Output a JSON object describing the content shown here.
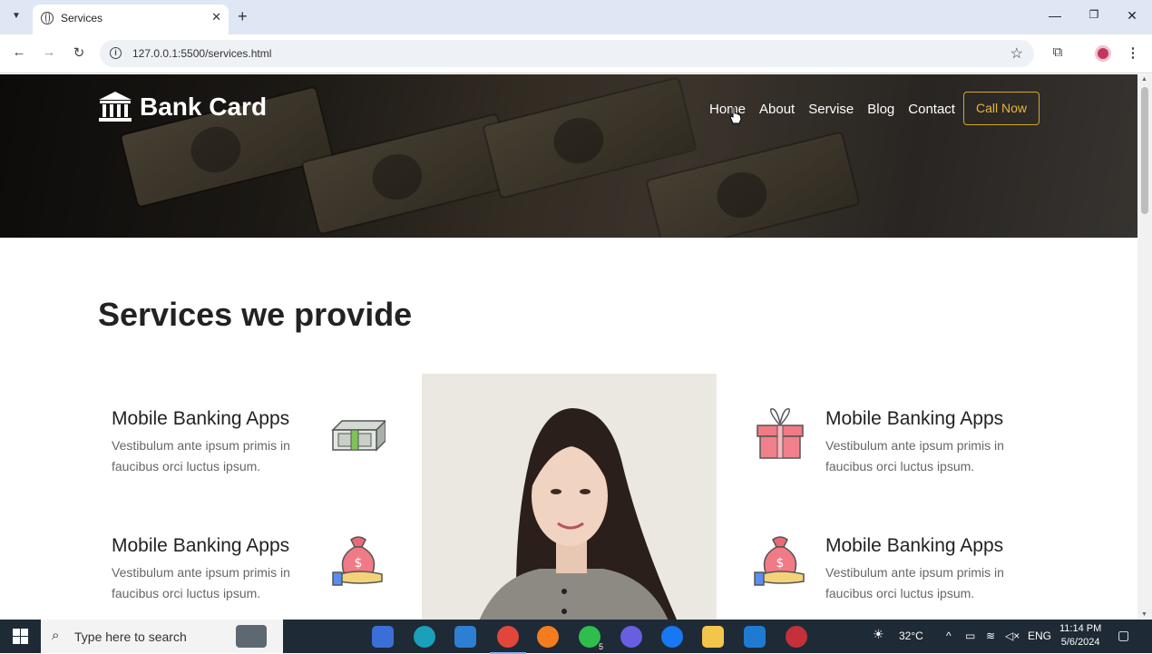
{
  "browser": {
    "tab_title": "Services",
    "url": "127.0.0.1:5500/services.html"
  },
  "site": {
    "brand": "Bank Card",
    "nav": [
      "Home",
      "About",
      "Servise",
      "Blog",
      "Contact"
    ],
    "cta": "Call Now"
  },
  "section": {
    "title_normal": "Services",
    "title_bold": "we provide"
  },
  "services": [
    {
      "title": "Mobile Banking Apps",
      "desc": "Vestibulum ante ipsum primis in faucibus orci luctus ipsum.",
      "icon": "cash-icon"
    },
    {
      "title": "Mobile Banking Apps",
      "desc": "Vestibulum ante ipsum primis in faucibus orci luctus ipsum.",
      "icon": "gift-icon"
    },
    {
      "title": "Mobile Banking Apps",
      "desc": "Vestibulum ante ipsum primis in faucibus orci luctus ipsum.",
      "icon": "money-bag-hand-icon"
    },
    {
      "title": "Mobile Banking Apps",
      "desc": "Vestibulum ante ipsum primis in faucibus orci luctus ipsum.",
      "icon": "money-bag-hand-icon"
    }
  ],
  "taskbar": {
    "search_placeholder": "Type here to search",
    "temperature": "32°C",
    "language": "ENG",
    "time": "11:14 PM",
    "date": "5/6/2024",
    "whatsapp_badge": "5"
  },
  "colors": {
    "accent": "#e7b53c",
    "taskbar": "#1e2a36"
  }
}
